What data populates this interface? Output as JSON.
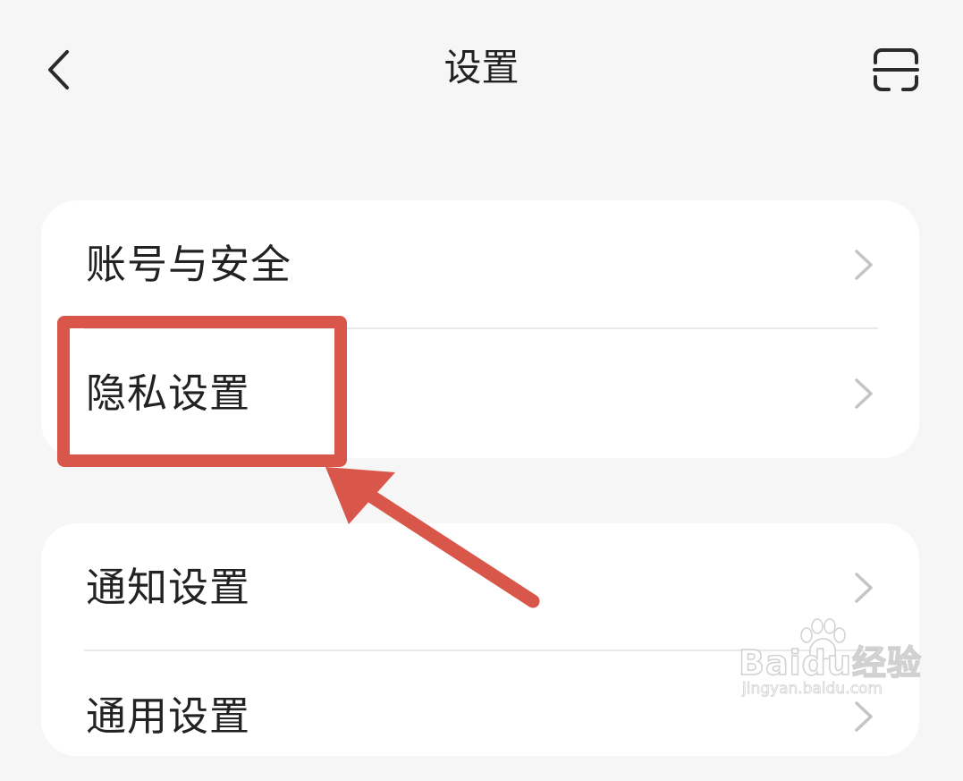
{
  "header": {
    "title": "设置",
    "back_icon": "chevron-left-icon",
    "scan_icon": "scan-icon"
  },
  "settings_groups": [
    {
      "items": [
        {
          "label": "账号与安全",
          "icon": "chevron-right-icon"
        },
        {
          "label": "隐私设置",
          "icon": "chevron-right-icon"
        }
      ]
    },
    {
      "items": [
        {
          "label": "通知设置",
          "icon": "chevron-right-icon"
        },
        {
          "label": "通用设置",
          "icon": "chevron-right-icon"
        }
      ]
    }
  ],
  "annotation": {
    "highlight_color": "#d9574a",
    "target": "隐私设置"
  },
  "watermark": {
    "brand": "Baidu经验",
    "url": "jingyan.baidu.com"
  },
  "colors": {
    "background": "#f6f6f6",
    "card": "#ffffff",
    "text": "#222222",
    "chevron": "#c4c4c4"
  }
}
